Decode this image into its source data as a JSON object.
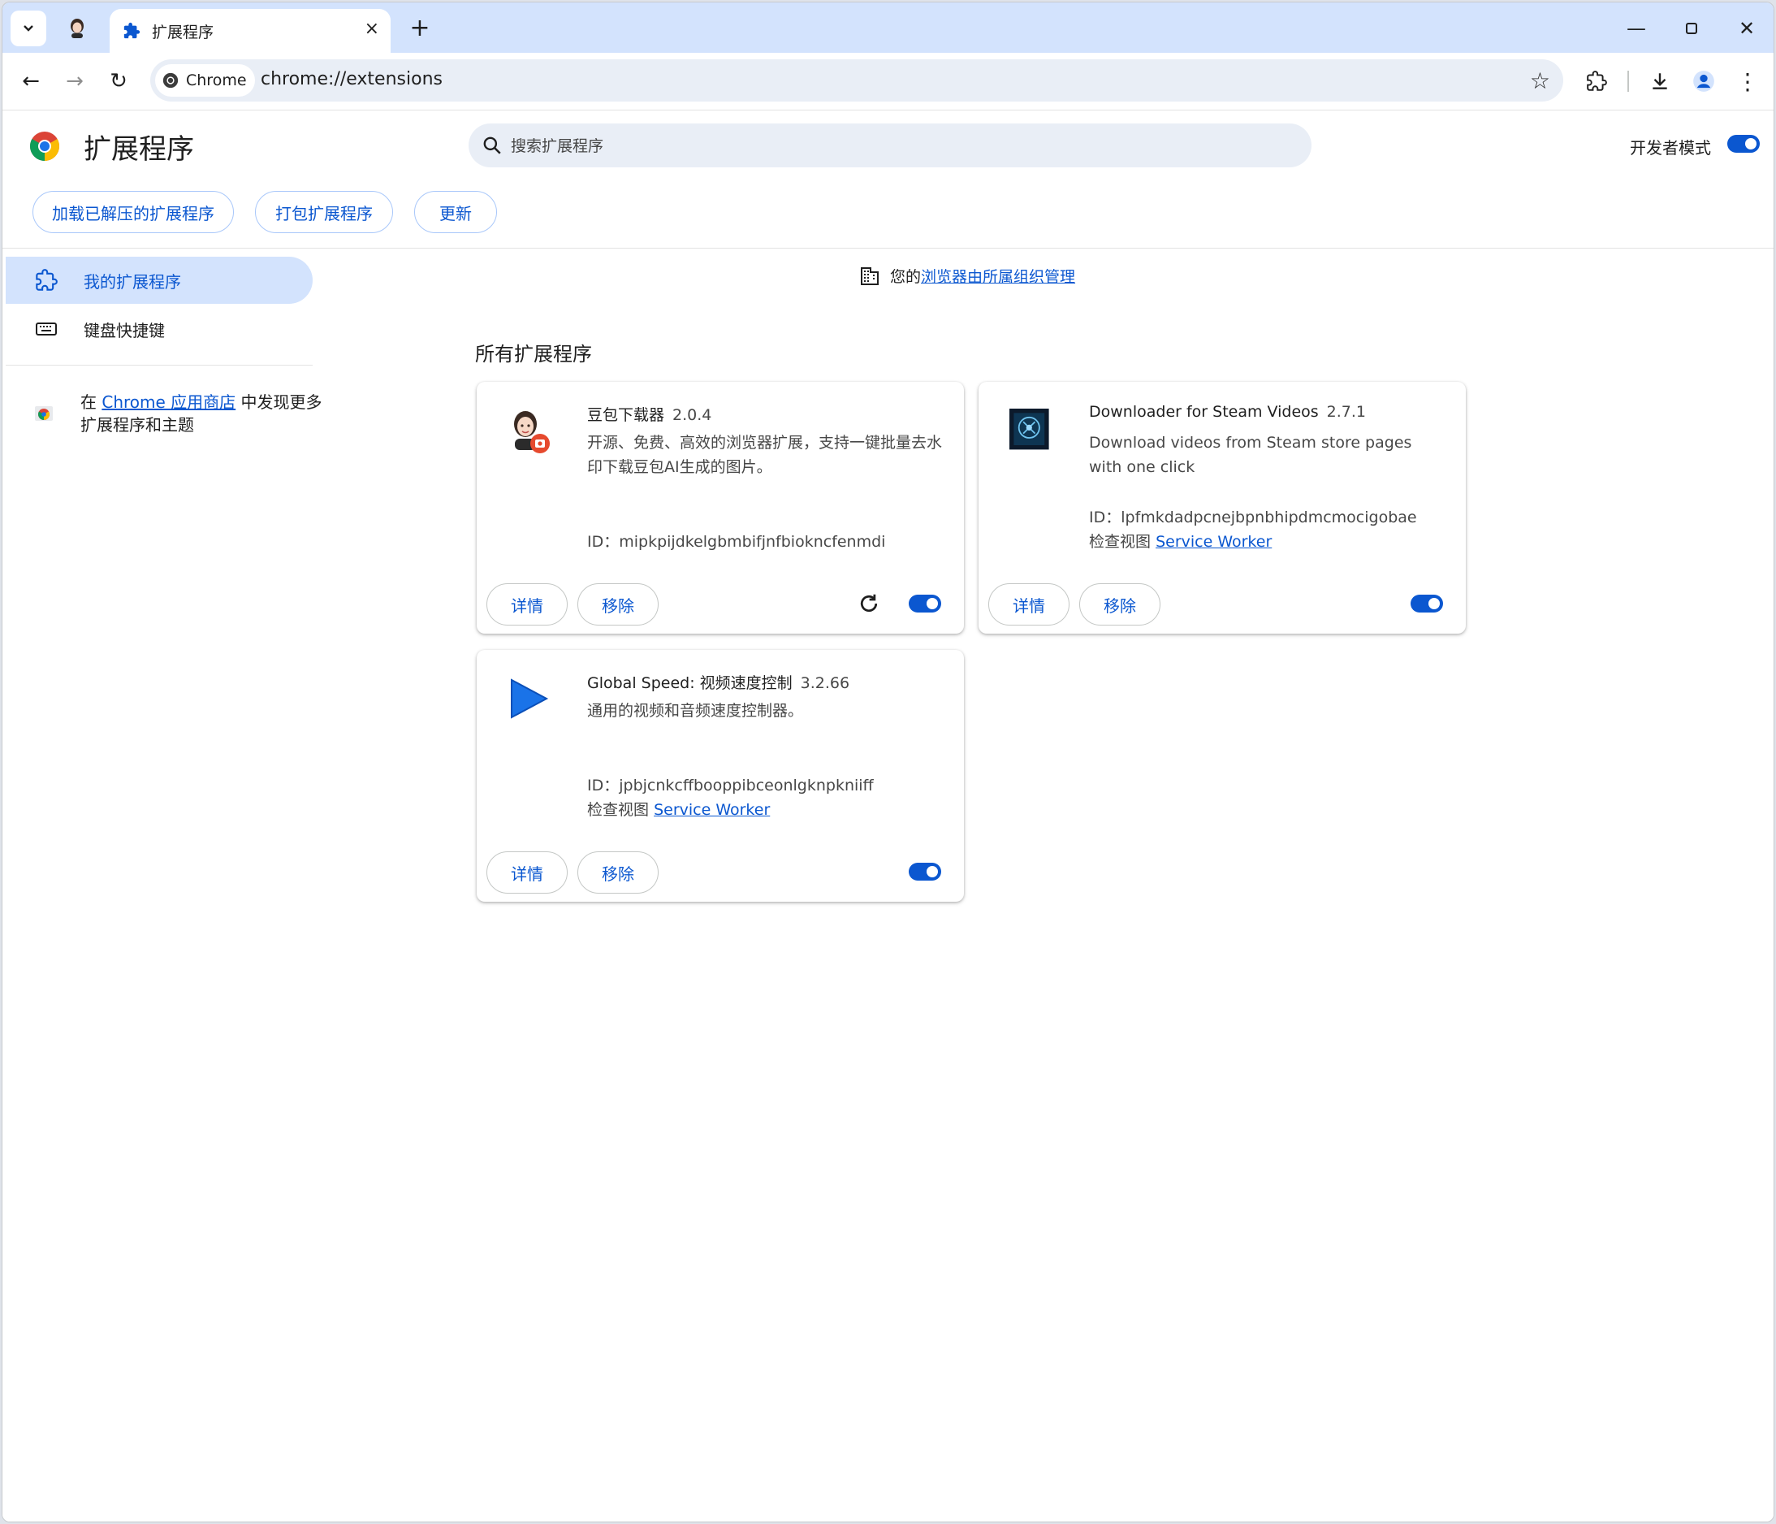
{
  "window": {
    "tab_title": "扩展程序",
    "tab_close": "×",
    "new_tab": "+",
    "minimize": "—",
    "maximize": "☐",
    "close": "✕"
  },
  "toolbar": {
    "back": "←",
    "forward": "→",
    "reload": "↻",
    "site_chip": "Chrome",
    "url": "chrome://extensions",
    "bookmark": "☆",
    "menu": "⋮"
  },
  "header": {
    "title": "扩展程序",
    "search_placeholder": "搜索扩展程序",
    "dev_mode_label": "开发者模式",
    "dev_mode_on": true,
    "buttons": {
      "load_unpacked": "加载已解压的扩展程序",
      "pack": "打包扩展程序",
      "update": "更新"
    }
  },
  "sidebar": {
    "items": [
      {
        "label": "我的扩展程序",
        "active": true
      },
      {
        "label": "键盘快捷键",
        "active": false
      }
    ],
    "store_prefix": "在 ",
    "store_link": "Chrome 应用商店",
    "store_suffix": " 中发现更多扩展程序和主题"
  },
  "managed": {
    "prefix": "您的",
    "link": "浏览器由所属组织管理"
  },
  "section_title": "所有扩展程序",
  "extensions": [
    {
      "name": "豆包下载器",
      "version": "2.0.4",
      "description": "开源、免费、高效的浏览器扩展，支持一键批量去水印下载豆包AI生成的图片。",
      "id_label": "ID：",
      "id": "mipkpijdkelgbmbifjnfbiokncfenmdi",
      "details": "详情",
      "remove": "移除",
      "enabled": true
    },
    {
      "name": "Downloader for Steam Videos",
      "version": "2.7.1",
      "description": "Download videos from Steam store pages with one click",
      "id_label": "ID：",
      "id": "lpfmkdadpcnejbpnbhipdmcmocigobae",
      "views_label": "检查视图",
      "views_link": "Service Worker",
      "details": "详情",
      "remove": "移除",
      "enabled": true
    },
    {
      "name": "Global Speed: 视频速度控制",
      "version": "3.2.66",
      "description": "通用的视频和音频速度控制器。",
      "id_label": "ID：",
      "id": "jpbjcnkcffbooppibceonlgknpkniiff",
      "views_label": "检查视图",
      "views_link": "Service Worker",
      "details": "详情",
      "remove": "移除",
      "enabled": true
    }
  ],
  "colors": {
    "accent": "#0b57d0",
    "tabstrip": "#d3e3fd",
    "omnibox": "#e9eef6"
  }
}
